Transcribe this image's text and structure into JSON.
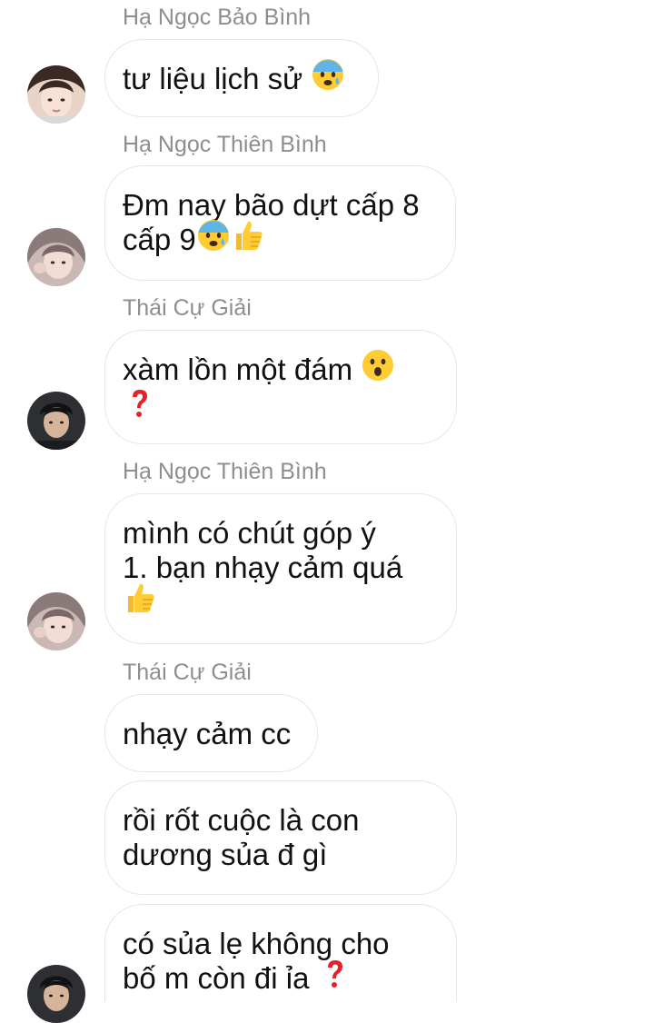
{
  "messages": [
    {
      "sender": "Hạ Ngọc Bảo Bình",
      "lines": [
        "tư liệu lịch sử"
      ],
      "emoji": [
        "anxious-sweat-face-icon"
      ]
    },
    {
      "sender": "Hạ Ngọc Thiên Bình",
      "lines": [
        "Đm nay bão dựt cấp 8",
        "cấp 9"
      ],
      "emoji": [
        "anxious-sweat-face-icon",
        "thumbs-up-icon"
      ]
    },
    {
      "sender": "Thái Cự Giải",
      "lines": [
        "xàm lồn một đám"
      ],
      "emoji": [
        "surprised-face-icon",
        "red-question-mark-icon"
      ]
    },
    {
      "sender": "Hạ Ngọc Thiên Bình",
      "lines": [
        "mình có chút góp ý",
        "1. bạn nhạy cảm quá"
      ],
      "emoji": [
        "thumbs-up-icon"
      ]
    },
    {
      "sender": "Thái Cự Giải",
      "lines": [
        "nhạy cảm cc"
      ]
    },
    {
      "lines": [
        "rồi rốt cuộc là con",
        "dương sủa đ gì"
      ]
    },
    {
      "lines": [
        "có sủa lẹ không cho",
        "bố m còn đi ỉa"
      ],
      "emoji": [
        "red-question-mark-icon"
      ]
    }
  ],
  "colors": {
    "sender_text": "#8e8e8e",
    "bubble_border": "#e6e6e6",
    "message_text": "#111111",
    "emoji_yellow": "#ffcc33",
    "emoji_blue": "#5fb4e8",
    "question_red": "#e0242b"
  }
}
